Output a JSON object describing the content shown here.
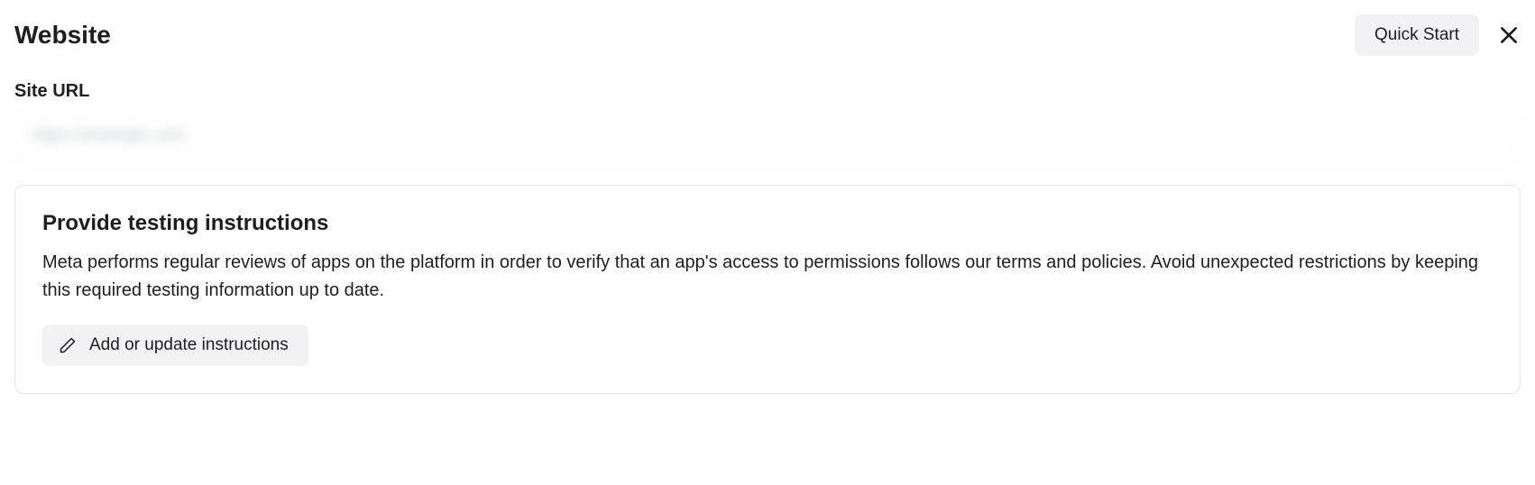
{
  "header": {
    "title": "Website",
    "quick_start_label": "Quick Start"
  },
  "site_url": {
    "label": "Site URL",
    "value": "https://example.com"
  },
  "instructions_card": {
    "title": "Provide testing instructions",
    "body": "Meta performs regular reviews of apps on the platform in order to verify that an app's access to permissions follows our terms and policies. Avoid unexpected restrictions by keeping this required testing information up to date.",
    "button_label": "Add or update instructions"
  }
}
